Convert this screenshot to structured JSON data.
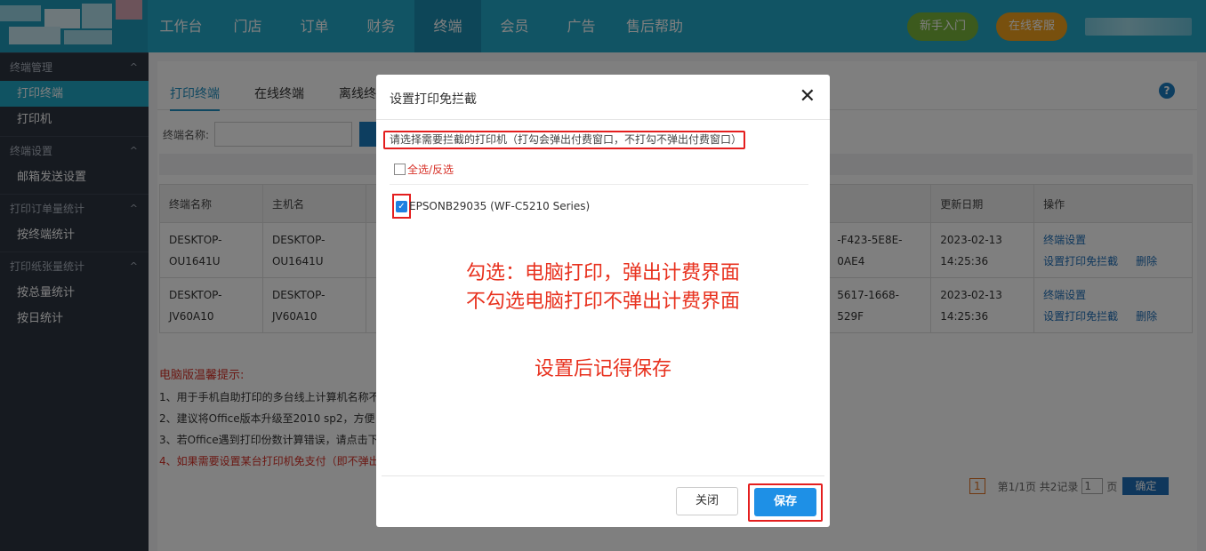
{
  "nav": {
    "items": [
      "工作台",
      "门店",
      "订单",
      "财务",
      "终端",
      "会员",
      "广告",
      "售后帮助"
    ],
    "active_index": 4,
    "beginner_label": "新手入门",
    "support_label": "在线客服"
  },
  "sidebar": {
    "groups": [
      {
        "title": "终端管理",
        "items": [
          "打印终端",
          "打印机"
        ]
      },
      {
        "title": "终端设置",
        "items": [
          "邮箱发送设置"
        ]
      },
      {
        "title": "打印订单量统计",
        "items": [
          "按终端统计"
        ]
      },
      {
        "title": "打印纸张量统计",
        "items": [
          "按总量统计",
          "按日统计"
        ]
      }
    ],
    "caret": "^"
  },
  "tabs": [
    "打印终端",
    "在线终端",
    "离线终"
  ],
  "search": {
    "label": "终端名称:"
  },
  "table": {
    "headers": [
      "终端名称",
      "主机名",
      "更新日期",
      "操作"
    ],
    "rows": [
      {
        "terminal": "DESKTOP-OU1641U",
        "terminal_l1": "DESKTOP-",
        "terminal_l2": "OU1641U",
        "host_l1": "DESKTOP-",
        "host_l2": "OU1641U",
        "id_l1": "-F423-5E8E-",
        "id_l2": "0AE4",
        "date": "2023-02-13",
        "time": "14:25:36",
        "op1": "终端设置",
        "op2": "设置打印免拦截",
        "op3": "删除"
      },
      {
        "terminal": "DESKTOP-JV60A10",
        "terminal_l1": "DESKTOP-",
        "terminal_l2": "JV60A10",
        "host_l1": "DESKTOP-",
        "host_l2": "JV60A10",
        "id_l1": "5617-1668-",
        "id_l2": "529F",
        "date": "2023-02-13",
        "time": "14:25:36",
        "op1": "终端设置",
        "op2": "设置打印免拦截",
        "op3": "删除"
      }
    ]
  },
  "tips": {
    "title": "电脑版温馨提示:",
    "lines": [
      "1、用于手机自助打印的多台线上计算机名称不",
      "2、建议将Office版本升级至2010 sp2，方便",
      "3、若Office遇到打印份数计算错误，请点击下",
      "4、如果需要设置某台打印机免支付（即不弹出"
    ]
  },
  "pager": {
    "current": "1",
    "summary": "第1/1页 共2记录",
    "page_value": "1",
    "page_unit": "页",
    "ok_label": "确定"
  },
  "dialog": {
    "title": "设置打印免拦截",
    "close_symbol": "✕",
    "notice": "请选择需要拦截的打印机（打勾会弹出付费窗口，不打勾不弹出付费窗口）",
    "select_all": "全选/反选",
    "printer": {
      "name": "EPSONB29035 (WF-C5210 Series)",
      "checked": true
    },
    "annotation1": "勾选：电脑打印，弹出计费界面",
    "annotation2": "不勾选电脑打印不弹出计费界面",
    "annotation3": "设置后记得保存",
    "close_label": "关闭",
    "save_label": "保存"
  },
  "colors": {
    "topbar": "#22a8c8",
    "sidebar": "#2d3440",
    "accent": "#1e90e6",
    "highlight": "#e41e1e"
  }
}
